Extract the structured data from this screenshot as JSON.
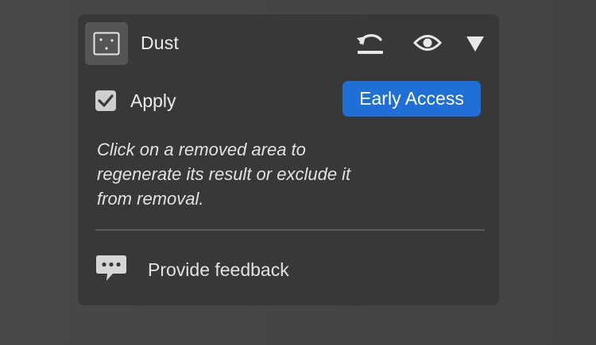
{
  "panel": {
    "title": "Dust",
    "tool_icon": "dust-frame-icon",
    "header_actions": [
      {
        "name": "reset",
        "icon": "undo-reset-icon"
      },
      {
        "name": "visibility",
        "icon": "eye-icon"
      },
      {
        "name": "collapse",
        "icon": "triangle-down-icon"
      }
    ]
  },
  "apply": {
    "label": "Apply",
    "checked": true
  },
  "badge": {
    "label": "Early Access",
    "color": "#1f6fd6"
  },
  "hint": {
    "lines": [
      "Click on a removed area to",
      "regenerate its result or exclude it",
      "from removal."
    ]
  },
  "feedback": {
    "label": "Provide feedback",
    "icon": "speech-bubble-icon"
  }
}
